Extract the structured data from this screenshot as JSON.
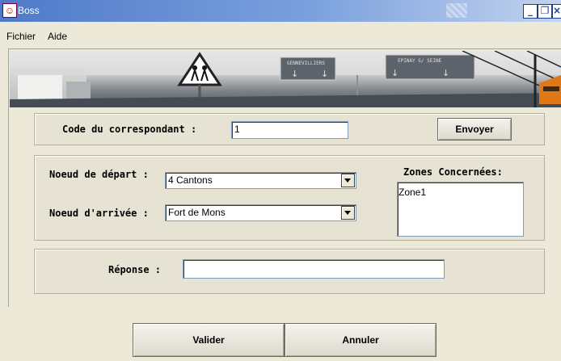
{
  "window": {
    "title": "Boss"
  },
  "menu": {
    "items": [
      "Fichier",
      "Aide"
    ]
  },
  "banner": {
    "signs": [
      "GENNEVILLIERS",
      "EPINAY S/ SEINE"
    ]
  },
  "form": {
    "code_label": "Code du correspondant :",
    "code_value": "1",
    "send_button": "Envoyer",
    "depart_label": "Noeud de départ :",
    "depart_value": "4 Cantons",
    "arrivee_label": "Noeud d'arrivée :",
    "arrivee_value": "Fort de Mons",
    "zones_label": "Zones Concernées:",
    "zones_value": "Zone1",
    "reponse_label": "Réponse :",
    "reponse_value": ""
  },
  "footer": {
    "validate_button": "Valider",
    "cancel_button": "Annuler"
  }
}
